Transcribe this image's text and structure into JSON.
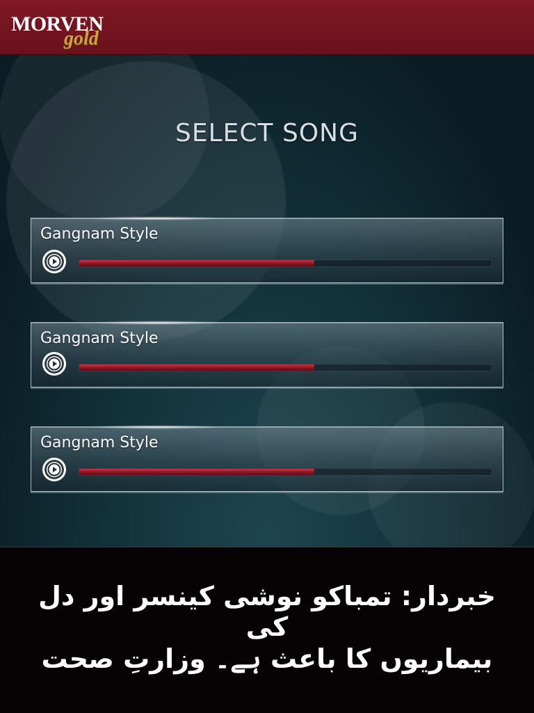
{
  "header": {
    "logo_main": "MORVEN",
    "logo_sub": "gold",
    "background_color": "#7a1520"
  },
  "main": {
    "title": "SELECT SONG"
  },
  "songs": [
    {
      "title": "Gangnam Style",
      "progress_fraction": 0.57,
      "play_icon": "play-icon"
    },
    {
      "title": "Gangnam Style",
      "progress_fraction": 0.57,
      "play_icon": "play-icon"
    },
    {
      "title": "Gangnam Style",
      "progress_fraction": 0.57,
      "play_icon": "play-icon"
    }
  ],
  "footer": {
    "warning_line1": "خبردار: تمباکو نوشی کینسر اور دل کی",
    "warning_line2": "بیماریوں کا باعث ہے۔ وزارتِ صحت"
  },
  "colors": {
    "accent": "#8e1625",
    "progress_border": "#8a1a26",
    "title_text": "#d9dee0"
  }
}
